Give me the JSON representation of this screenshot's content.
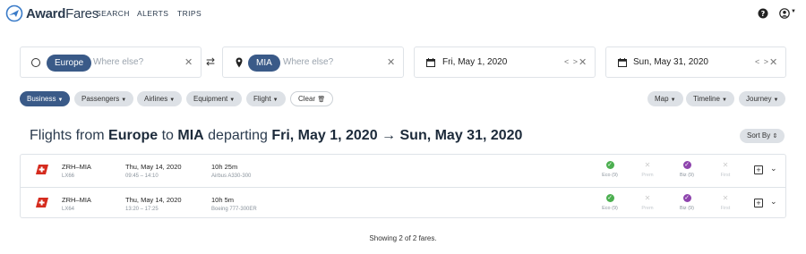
{
  "app": {
    "brand_bold": "Award",
    "brand_light": "Fares",
    "nav": [
      "SEARCH",
      "ALERTS",
      "TRIPS"
    ]
  },
  "search": {
    "origin_chip": "Europe",
    "origin_placeholder": "Where else?",
    "destination_chip": "MIA",
    "destination_placeholder": "Where else?",
    "start_date": "Fri, May 1, 2020",
    "end_date": "Sun, May 31, 2020",
    "date_nav": "< >"
  },
  "filters": {
    "left": [
      "Business",
      "Passengers",
      "Airlines",
      "Equipment",
      "Flight"
    ],
    "clear_label": "Clear",
    "right": [
      "Map",
      "Timeline",
      "Journey"
    ]
  },
  "headline": {
    "prefix": "Flights from ",
    "origin": "Europe",
    "to": " to ",
    "destination": "MIA",
    "departing": " departing ",
    "range": "Fri, May 1, 2020 → Sun, May 31, 2020"
  },
  "sort_label": "Sort By",
  "flights": [
    {
      "route": "ZRH–MIA",
      "flight_no": "LX66",
      "date": "Thu, May 14, 2020",
      "times": "09:45 – 14:10",
      "duration": "10h 25m",
      "aircraft": "Airbus A330-300",
      "cabins": [
        {
          "label": "Eco (9)",
          "available": true,
          "color": "#4caf50"
        },
        {
          "label": "Prem",
          "available": false,
          "color": "#cccccc"
        },
        {
          "label": "Biz (9)",
          "available": true,
          "color": "#8e44ad"
        },
        {
          "label": "First",
          "available": false,
          "color": "#cccccc"
        }
      ]
    },
    {
      "route": "ZRH–MIA",
      "flight_no": "LX64",
      "date": "Thu, May 14, 2020",
      "times": "13:20 – 17:25",
      "duration": "10h 5m",
      "aircraft": "Boeing 777-300ER",
      "cabins": [
        {
          "label": "Eco (9)",
          "available": true,
          "color": "#4caf50"
        },
        {
          "label": "Prem",
          "available": false,
          "color": "#cccccc"
        },
        {
          "label": "Biz (9)",
          "available": true,
          "color": "#8e44ad"
        },
        {
          "label": "First",
          "available": false,
          "color": "#cccccc"
        }
      ]
    }
  ],
  "footer": "Showing 2 of 2 fares.",
  "colors": {
    "accent": "#3a5a88",
    "airline_red": "#d52b1e"
  }
}
